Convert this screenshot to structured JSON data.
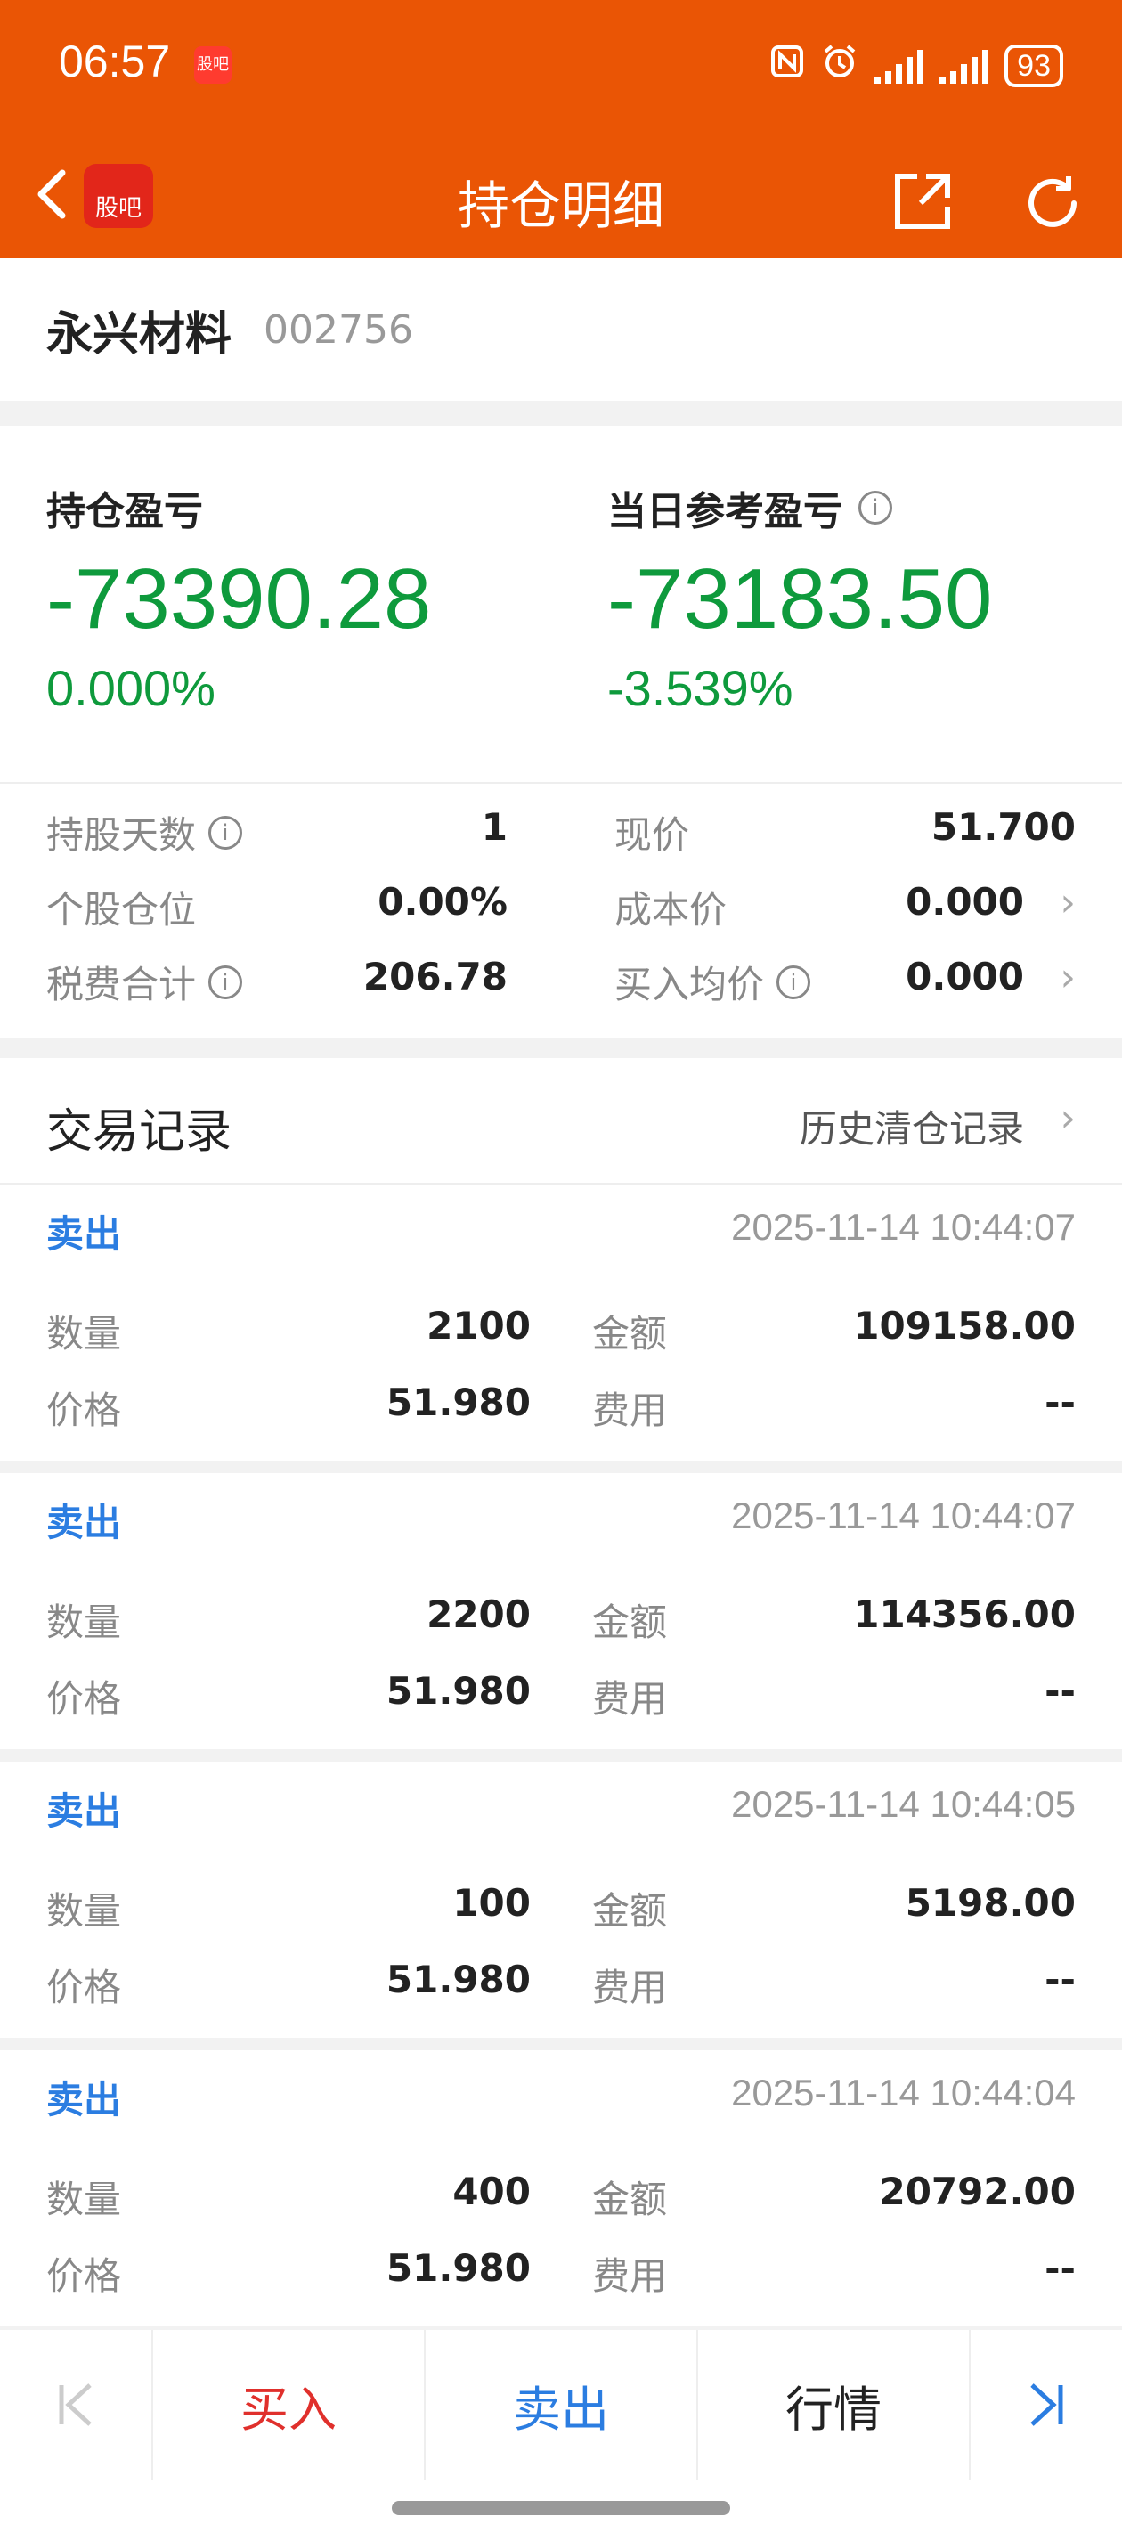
{
  "status_bar": {
    "time": "06:57",
    "app_badge": "股吧",
    "battery": "93"
  },
  "nav": {
    "title": "持仓明细",
    "logo_text": "股吧"
  },
  "stock": {
    "name": "永兴材料",
    "code": "002756"
  },
  "pnl": {
    "position_label": "持仓盈亏",
    "position_value": "-73390.28",
    "position_pct": "0.000%",
    "daily_label": "当日参考盈亏",
    "daily_value": "-73183.50",
    "daily_pct": "-3.539%"
  },
  "stats": {
    "hold_days_label": "持股天数",
    "hold_days": "1",
    "current_price_label": "现价",
    "current_price": "51.700",
    "position_ratio_label": "个股仓位",
    "position_ratio": "0.00%",
    "cost_price_label": "成本价",
    "cost_price": "0.000",
    "fees_label": "税费合计",
    "fees": "206.78",
    "avg_buy_label": "买入均价",
    "avg_buy": "0.000"
  },
  "trades": {
    "title": "交易记录",
    "history_link": "历史清仓记录",
    "qty_label": "数量",
    "amount_label": "金额",
    "price_label": "价格",
    "fee_label": "费用",
    "records": [
      {
        "type": "卖出",
        "time": "2025-11-14 10:44:07",
        "qty": "2100",
        "amount": "109158.00",
        "price": "51.980",
        "fee": "--"
      },
      {
        "type": "卖出",
        "time": "2025-11-14 10:44:07",
        "qty": "2200",
        "amount": "114356.00",
        "price": "51.980",
        "fee": "--"
      },
      {
        "type": "卖出",
        "time": "2025-11-14 10:44:05",
        "qty": "100",
        "amount": "5198.00",
        "price": "51.980",
        "fee": "--"
      },
      {
        "type": "卖出",
        "time": "2025-11-14 10:44:04",
        "qty": "400",
        "amount": "20792.00",
        "price": "51.980",
        "fee": "--"
      }
    ]
  },
  "bottom_bar": {
    "buy": "买入",
    "sell": "卖出",
    "quote": "行情"
  },
  "colors": {
    "brand": "#ea5505",
    "loss_green": "#0e9a3c",
    "sell_blue": "#2b7de1",
    "buy_red": "#e0302c"
  }
}
